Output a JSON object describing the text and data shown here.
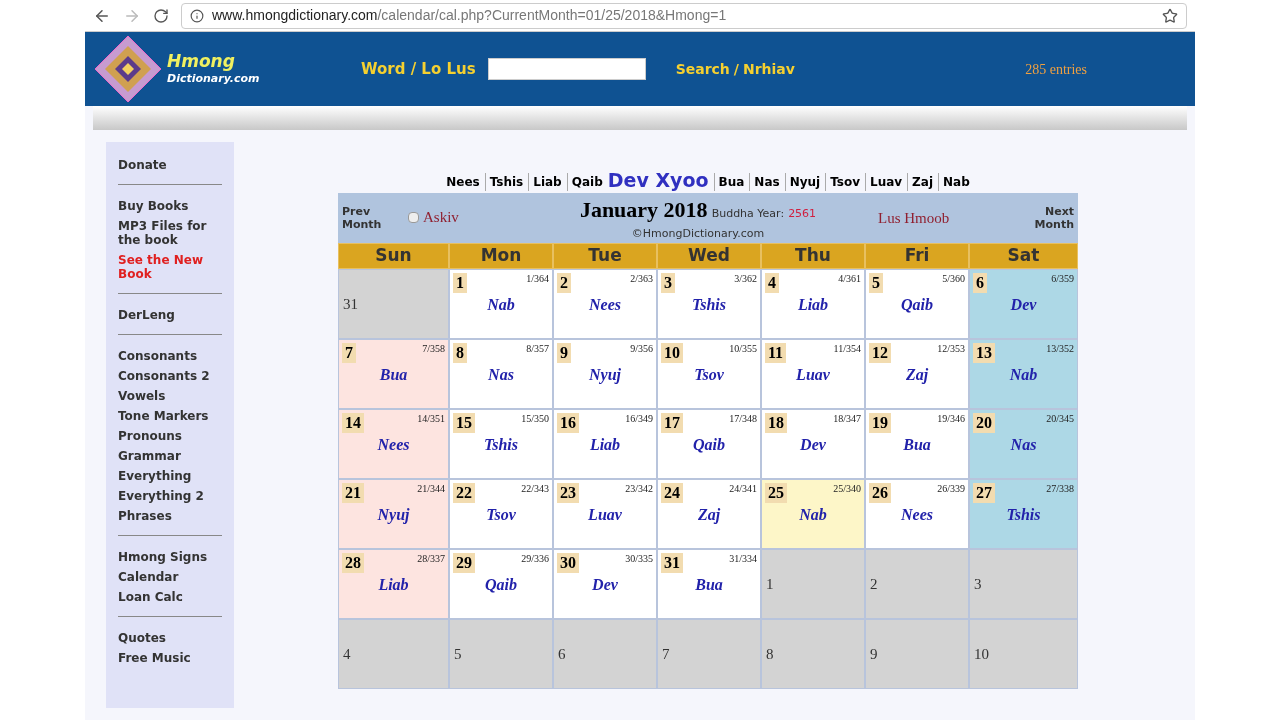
{
  "browser": {
    "url_host": "www.hmongdictionary.com",
    "url_path": "/calendar/cal.php?CurrentMonth=01/25/2018&Hmong=1"
  },
  "header": {
    "logo_line_1": "Hmong",
    "logo_line_2": "Dictionary.com",
    "word_label": "Word / Lo Lus",
    "search_label": "Search",
    "search_sep": "/",
    "search_label_2": "Nrhiav",
    "entries": "285 entries"
  },
  "sidebar": {
    "groups": [
      {
        "items": [
          {
            "label": "Donate",
            "highlight": false
          }
        ]
      },
      {
        "items": [
          {
            "label": "Buy Books",
            "highlight": false
          },
          {
            "label": "MP3 Files for the book",
            "highlight": false
          },
          {
            "label": "See the New Book",
            "highlight": true
          }
        ]
      },
      {
        "items": [
          {
            "label": "DerLeng",
            "highlight": false
          }
        ]
      },
      {
        "items": [
          {
            "label": "Consonants",
            "highlight": false
          },
          {
            "label": "Consonants 2",
            "highlight": false
          },
          {
            "label": "Vowels",
            "highlight": false
          },
          {
            "label": "Tone Markers",
            "highlight": false
          },
          {
            "label": "Pronouns",
            "highlight": false
          },
          {
            "label": "Grammar",
            "highlight": false
          },
          {
            "label": "Everything",
            "highlight": false
          },
          {
            "label": "Everything 2",
            "highlight": false
          },
          {
            "label": "Phrases",
            "highlight": false
          }
        ]
      },
      {
        "items": [
          {
            "label": "Hmong Signs",
            "highlight": false
          },
          {
            "label": "Calendar",
            "highlight": false
          },
          {
            "label": "Loan Calc",
            "highlight": false
          }
        ]
      },
      {
        "items": [
          {
            "label": "Quotes",
            "highlight": false
          },
          {
            "label": "Free Music",
            "highlight": false
          }
        ]
      }
    ]
  },
  "month_names": [
    {
      "label": "Nees",
      "selected": false
    },
    {
      "label": "Tshis",
      "selected": false
    },
    {
      "label": "Liab",
      "selected": false
    },
    {
      "label": "Qaib",
      "selected": false
    },
    {
      "label": "Dev Xyoo",
      "selected": true
    },
    {
      "label": "Bua",
      "selected": false
    },
    {
      "label": "Nas",
      "selected": false
    },
    {
      "label": "Nyuj",
      "selected": false
    },
    {
      "label": "Tsov",
      "selected": false
    },
    {
      "label": "Luav",
      "selected": false
    },
    {
      "label": "Zaj",
      "selected": false
    },
    {
      "label": "Nab",
      "selected": false
    }
  ],
  "calendar": {
    "prev": "Prev Month",
    "askiv": {
      "label": "Askiv",
      "checked": false
    },
    "title": "January 2018",
    "buddha_label": "Buddha Year:",
    "buddha_year": "2561",
    "copyright": "©HmongDictionary.com",
    "lus_hmoob": "Lus Hmoob",
    "next": "Next Month",
    "weekdays": [
      "Sun",
      "Mon",
      "Tue",
      "Wed",
      "Thu",
      "Fri",
      "Sat"
    ],
    "weeks": [
      [
        {
          "kind": "other",
          "day": "31"
        },
        {
          "kind": "day",
          "day": "1",
          "count": "1/364",
          "name": "Nab",
          "color": "#ffffff"
        },
        {
          "kind": "day",
          "day": "2",
          "count": "2/363",
          "name": "Nees",
          "color": "#ffffff"
        },
        {
          "kind": "day",
          "day": "3",
          "count": "3/362",
          "name": "Tshis",
          "color": "#ffffff"
        },
        {
          "kind": "day",
          "day": "4",
          "count": "4/361",
          "name": "Liab",
          "color": "#ffffff"
        },
        {
          "kind": "day",
          "day": "5",
          "count": "5/360",
          "name": "Qaib",
          "color": "#ffffff"
        },
        {
          "kind": "day",
          "day": "6",
          "count": "6/359",
          "name": "Dev",
          "color": "#add8e6"
        }
      ],
      [
        {
          "kind": "day",
          "day": "7",
          "count": "7/358",
          "name": "Bua",
          "color": "#fde4e0"
        },
        {
          "kind": "day",
          "day": "8",
          "count": "8/357",
          "name": "Nas",
          "color": "#ffffff"
        },
        {
          "kind": "day",
          "day": "9",
          "count": "9/356",
          "name": "Nyuj",
          "color": "#ffffff"
        },
        {
          "kind": "day",
          "day": "10",
          "count": "10/355",
          "name": "Tsov",
          "color": "#ffffff"
        },
        {
          "kind": "day",
          "day": "11",
          "count": "11/354",
          "name": "Luav",
          "color": "#ffffff"
        },
        {
          "kind": "day",
          "day": "12",
          "count": "12/353",
          "name": "Zaj",
          "color": "#ffffff"
        },
        {
          "kind": "day",
          "day": "13",
          "count": "13/352",
          "name": "Nab",
          "color": "#add8e6"
        }
      ],
      [
        {
          "kind": "day",
          "day": "14",
          "count": "14/351",
          "name": "Nees",
          "color": "#fde4e0"
        },
        {
          "kind": "day",
          "day": "15",
          "count": "15/350",
          "name": "Tshis",
          "color": "#ffffff"
        },
        {
          "kind": "day",
          "day": "16",
          "count": "16/349",
          "name": "Liab",
          "color": "#ffffff"
        },
        {
          "kind": "day",
          "day": "17",
          "count": "17/348",
          "name": "Qaib",
          "color": "#ffffff"
        },
        {
          "kind": "day",
          "day": "18",
          "count": "18/347",
          "name": "Dev",
          "color": "#ffffff"
        },
        {
          "kind": "day",
          "day": "19",
          "count": "19/346",
          "name": "Bua",
          "color": "#ffffff"
        },
        {
          "kind": "day",
          "day": "20",
          "count": "20/345",
          "name": "Nas",
          "color": "#add8e6"
        }
      ],
      [
        {
          "kind": "day",
          "day": "21",
          "count": "21/344",
          "name": "Nyuj",
          "color": "#fde4e0"
        },
        {
          "kind": "day",
          "day": "22",
          "count": "22/343",
          "name": "Tsov",
          "color": "#ffffff"
        },
        {
          "kind": "day",
          "day": "23",
          "count": "23/342",
          "name": "Luav",
          "color": "#ffffff"
        },
        {
          "kind": "day",
          "day": "24",
          "count": "24/341",
          "name": "Zaj",
          "color": "#ffffff"
        },
        {
          "kind": "day",
          "day": "25",
          "count": "25/340",
          "name": "Nab",
          "color": "#fdf6c8"
        },
        {
          "kind": "day",
          "day": "26",
          "count": "26/339",
          "name": "Nees",
          "color": "#ffffff"
        },
        {
          "kind": "day",
          "day": "27",
          "count": "27/338",
          "name": "Tshis",
          "color": "#add8e6"
        }
      ],
      [
        {
          "kind": "day",
          "day": "28",
          "count": "28/337",
          "name": "Liab",
          "color": "#fde4e0"
        },
        {
          "kind": "day",
          "day": "29",
          "count": "29/336",
          "name": "Qaib",
          "color": "#ffffff"
        },
        {
          "kind": "day",
          "day": "30",
          "count": "30/335",
          "name": "Dev",
          "color": "#ffffff"
        },
        {
          "kind": "day",
          "day": "31",
          "count": "31/334",
          "name": "Bua",
          "color": "#ffffff"
        },
        {
          "kind": "other",
          "day": "1"
        },
        {
          "kind": "other",
          "day": "2"
        },
        {
          "kind": "other",
          "day": "3"
        }
      ],
      [
        {
          "kind": "other",
          "day": "4"
        },
        {
          "kind": "other",
          "day": "5"
        },
        {
          "kind": "other",
          "day": "6"
        },
        {
          "kind": "other",
          "day": "7"
        },
        {
          "kind": "other",
          "day": "8"
        },
        {
          "kind": "other",
          "day": "9"
        },
        {
          "kind": "other",
          "day": "10"
        }
      ]
    ]
  }
}
